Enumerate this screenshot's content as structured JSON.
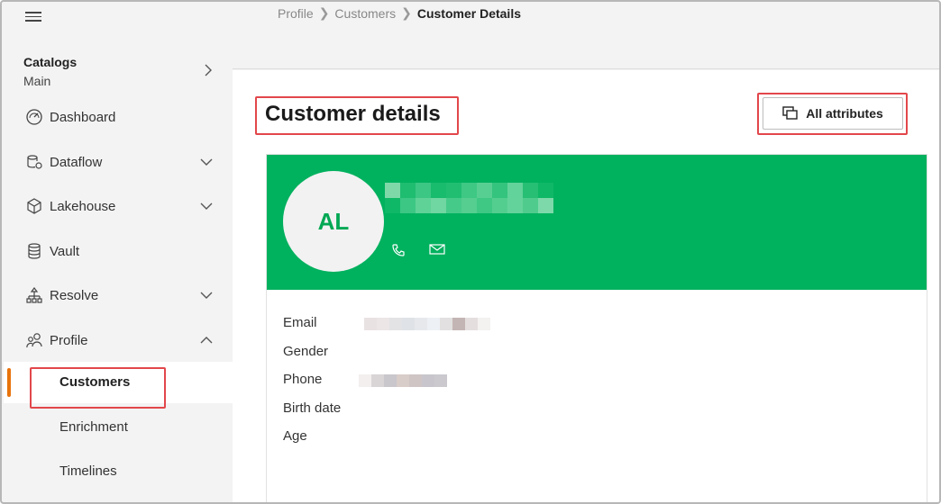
{
  "sidebar": {
    "catalog": {
      "title": "Catalogs",
      "subtitle": "Main"
    },
    "items": [
      {
        "label": "Dashboard",
        "icon": "dashboard-gauge-icon"
      },
      {
        "label": "Dataflow",
        "icon": "dataflow-icon"
      },
      {
        "label": "Lakehouse",
        "icon": "lakehouse-cube-icon"
      },
      {
        "label": "Vault",
        "icon": "vault-database-icon"
      },
      {
        "label": "Resolve",
        "icon": "resolve-hierarchy-icon"
      },
      {
        "label": "Profile",
        "icon": "profile-users-icon"
      }
    ],
    "profile_sub": [
      {
        "label": "Customers",
        "active": true
      },
      {
        "label": "Enrichment"
      },
      {
        "label": "Timelines"
      }
    ]
  },
  "breadcrumb": [
    "Profile",
    "Customers",
    "Customer Details"
  ],
  "page": {
    "title": "Customer details",
    "all_attributes_label": "All attributes"
  },
  "customer": {
    "initials": "AL",
    "fields": [
      {
        "label": "Email"
      },
      {
        "label": "Gender"
      },
      {
        "label": "Phone"
      },
      {
        "label": "Birth date"
      },
      {
        "label": "Age"
      }
    ]
  },
  "colors": {
    "accent_green": "#00b15e",
    "active_indicator": "#e8730c",
    "highlight_red": "#e2474b"
  }
}
